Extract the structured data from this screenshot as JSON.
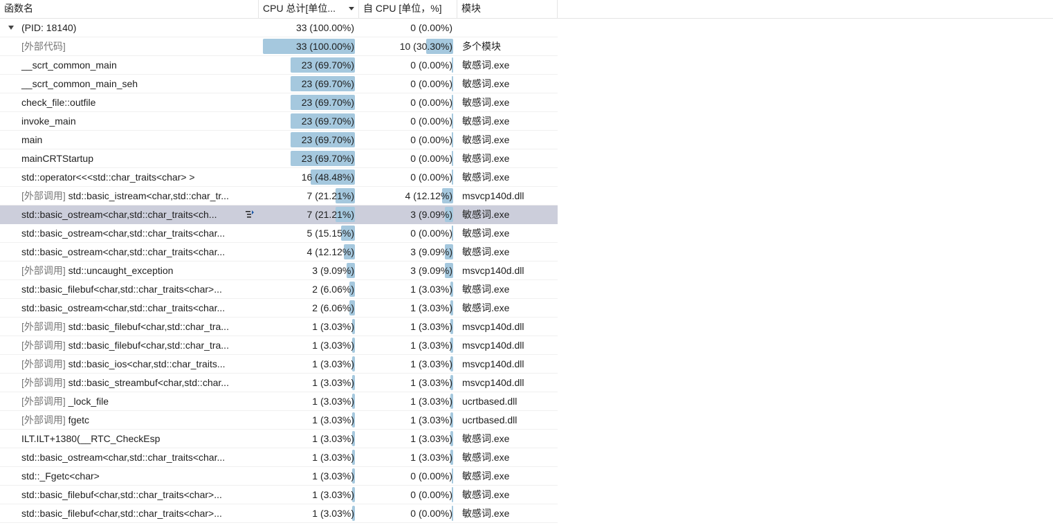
{
  "header": {
    "name": "函数名",
    "total": "CPU 总计[单位...",
    "self": "自 CPU [单位，%]",
    "module": "模块"
  },
  "colors": {
    "bar": "#a5c8de",
    "selected_row": "#cccedb"
  },
  "rows": [
    {
      "prefix": "",
      "name": "(PID: 18140)",
      "total": "33 (100.00%)",
      "total_pct": 100.0,
      "self": "0 (0.00%)",
      "self_pct": 0.0,
      "module": "",
      "root": true
    },
    {
      "prefix": "",
      "name": "[外部代码]",
      "total": "33 (100.00%)",
      "total_pct": 100.0,
      "self": "10 (30.30%)",
      "self_pct": 30.3,
      "module": "多个模块",
      "ext_name": true
    },
    {
      "prefix": "",
      "name": "__scrt_common_main",
      "total": "23 (69.70%)",
      "total_pct": 69.7,
      "self": "0 (0.00%)",
      "self_pct": 0.0,
      "module": "敏感词.exe"
    },
    {
      "prefix": "",
      "name": "__scrt_common_main_seh",
      "total": "23 (69.70%)",
      "total_pct": 69.7,
      "self": "0 (0.00%)",
      "self_pct": 0.0,
      "module": "敏感词.exe"
    },
    {
      "prefix": "",
      "name": "check_file::outfile",
      "total": "23 (69.70%)",
      "total_pct": 69.7,
      "self": "0 (0.00%)",
      "self_pct": 0.0,
      "module": "敏感词.exe"
    },
    {
      "prefix": "",
      "name": "invoke_main",
      "total": "23 (69.70%)",
      "total_pct": 69.7,
      "self": "0 (0.00%)",
      "self_pct": 0.0,
      "module": "敏感词.exe"
    },
    {
      "prefix": "",
      "name": "main",
      "total": "23 (69.70%)",
      "total_pct": 69.7,
      "self": "0 (0.00%)",
      "self_pct": 0.0,
      "module": "敏感词.exe"
    },
    {
      "prefix": "",
      "name": "mainCRTStartup",
      "total": "23 (69.70%)",
      "total_pct": 69.7,
      "self": "0 (0.00%)",
      "self_pct": 0.0,
      "module": "敏感词.exe"
    },
    {
      "prefix": "",
      "name": "std::operator<<<std::char_traits<char> >",
      "total": "16 (48.48%)",
      "total_pct": 48.48,
      "self": "0 (0.00%)",
      "self_pct": 0.0,
      "module": "敏感词.exe"
    },
    {
      "prefix": "[外部调用] ",
      "name": "std::basic_istream<char,std::char_tr...",
      "total": "7 (21.21%)",
      "total_pct": 21.21,
      "self": "4 (12.12%)",
      "self_pct": 12.12,
      "module": "msvcp140d.dll"
    },
    {
      "prefix": "",
      "name": "std::basic_ostream<char,std::char_traits<ch...",
      "total": "7 (21.21%)",
      "total_pct": 21.21,
      "self": "3 (9.09%)",
      "self_pct": 9.09,
      "module": "敏感词.exe",
      "selected": true
    },
    {
      "prefix": "",
      "name": "std::basic_ostream<char,std::char_traits<char...",
      "total": "5 (15.15%)",
      "total_pct": 15.15,
      "self": "0 (0.00%)",
      "self_pct": 0.0,
      "module": "敏感词.exe"
    },
    {
      "prefix": "",
      "name": "std::basic_ostream<char,std::char_traits<char...",
      "total": "4 (12.12%)",
      "total_pct": 12.12,
      "self": "3 (9.09%)",
      "self_pct": 9.09,
      "module": "敏感词.exe"
    },
    {
      "prefix": "[外部调用] ",
      "name": "std::uncaught_exception",
      "total": "3 (9.09%)",
      "total_pct": 9.09,
      "self": "3 (9.09%)",
      "self_pct": 9.09,
      "module": "msvcp140d.dll"
    },
    {
      "prefix": "",
      "name": "std::basic_filebuf<char,std::char_traits<char>...",
      "total": "2 (6.06%)",
      "total_pct": 6.06,
      "self": "1 (3.03%)",
      "self_pct": 3.03,
      "module": "敏感词.exe"
    },
    {
      "prefix": "",
      "name": "std::basic_ostream<char,std::char_traits<char...",
      "total": "2 (6.06%)",
      "total_pct": 6.06,
      "self": "1 (3.03%)",
      "self_pct": 3.03,
      "module": "敏感词.exe"
    },
    {
      "prefix": "[外部调用] ",
      "name": "std::basic_filebuf<char,std::char_tra...",
      "total": "1 (3.03%)",
      "total_pct": 3.03,
      "self": "1 (3.03%)",
      "self_pct": 3.03,
      "module": "msvcp140d.dll"
    },
    {
      "prefix": "[外部调用] ",
      "name": "std::basic_filebuf<char,std::char_tra...",
      "total": "1 (3.03%)",
      "total_pct": 3.03,
      "self": "1 (3.03%)",
      "self_pct": 3.03,
      "module": "msvcp140d.dll"
    },
    {
      "prefix": "[外部调用] ",
      "name": "std::basic_ios<char,std::char_traits...",
      "total": "1 (3.03%)",
      "total_pct": 3.03,
      "self": "1 (3.03%)",
      "self_pct": 3.03,
      "module": "msvcp140d.dll"
    },
    {
      "prefix": "[外部调用] ",
      "name": "std::basic_streambuf<char,std::char...",
      "total": "1 (3.03%)",
      "total_pct": 3.03,
      "self": "1 (3.03%)",
      "self_pct": 3.03,
      "module": "msvcp140d.dll"
    },
    {
      "prefix": "[外部调用] ",
      "name": "_lock_file",
      "total": "1 (3.03%)",
      "total_pct": 3.03,
      "self": "1 (3.03%)",
      "self_pct": 3.03,
      "module": "ucrtbased.dll"
    },
    {
      "prefix": "[外部调用] ",
      "name": "fgetc",
      "total": "1 (3.03%)",
      "total_pct": 3.03,
      "self": "1 (3.03%)",
      "self_pct": 3.03,
      "module": "ucrtbased.dll"
    },
    {
      "prefix": "",
      "name": "ILT.ILT+1380(__RTC_CheckEsp",
      "total": "1 (3.03%)",
      "total_pct": 3.03,
      "self": "1 (3.03%)",
      "self_pct": 3.03,
      "module": "敏感词.exe"
    },
    {
      "prefix": "",
      "name": "std::basic_ostream<char,std::char_traits<char...",
      "total": "1 (3.03%)",
      "total_pct": 3.03,
      "self": "1 (3.03%)",
      "self_pct": 3.03,
      "module": "敏感词.exe"
    },
    {
      "prefix": "",
      "name": "std::_Fgetc<char>",
      "total": "1 (3.03%)",
      "total_pct": 3.03,
      "self": "0 (0.00%)",
      "self_pct": 0.0,
      "module": "敏感词.exe"
    },
    {
      "prefix": "",
      "name": "std::basic_filebuf<char,std::char_traits<char>...",
      "total": "1 (3.03%)",
      "total_pct": 3.03,
      "self": "0 (0.00%)",
      "self_pct": 0.0,
      "module": "敏感词.exe"
    },
    {
      "prefix": "",
      "name": "std::basic_filebuf<char,std::char_traits<char>...",
      "total": "1 (3.03%)",
      "total_pct": 3.03,
      "self": "0 (0.00%)",
      "self_pct": 0.0,
      "module": "敏感词.exe"
    }
  ]
}
